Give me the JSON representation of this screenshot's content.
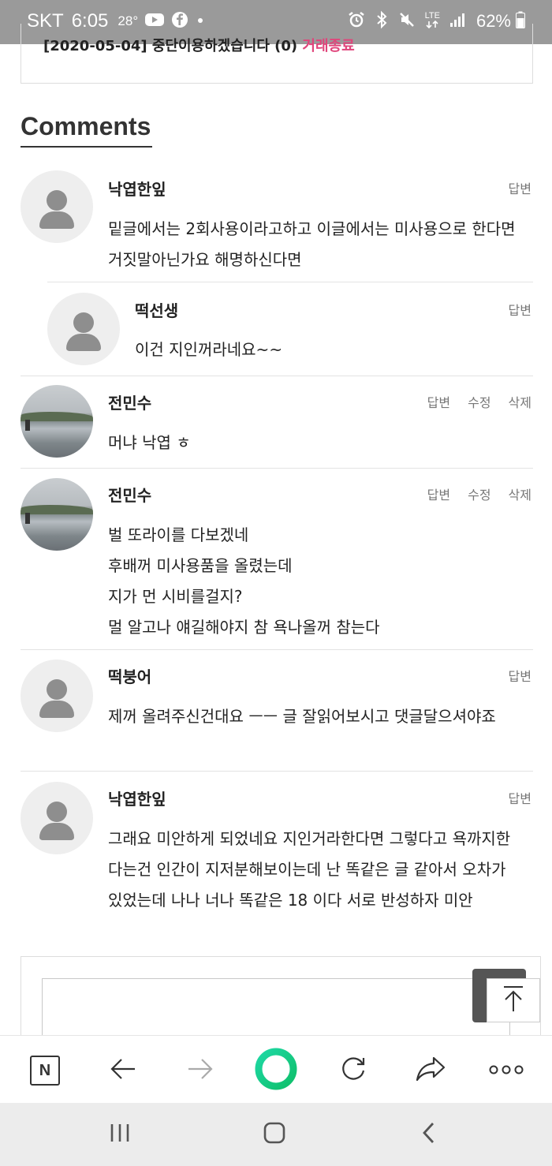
{
  "status_bar": {
    "carrier": "SKT",
    "time": "6:05",
    "temperature": "28°",
    "lte": "LTE",
    "battery": "62%"
  },
  "post": {
    "line_text": "[2020-05-04] 중단이용하겠습니다 (0)",
    "line_tag": "거래종료"
  },
  "comments_heading": "Comments",
  "comments": [
    {
      "author": "낙엽한잎",
      "avatar": "default",
      "actions": [
        "답변"
      ],
      "text": "밑글에서는 2회사용이라고하고 이글에서는 미사용으로 한다면 거짓말아닌가요 해명하신다면"
    },
    {
      "author": "떡선생",
      "avatar": "default",
      "actions": [
        "답변"
      ],
      "text": "이건 지인꺼라네요~~"
    },
    {
      "author": "전민수",
      "avatar": "photo",
      "actions": [
        "답변",
        "수정",
        "삭제"
      ],
      "text": "머냐 낙엽 ㅎ"
    },
    {
      "author": "전민수",
      "avatar": "photo",
      "actions": [
        "답변",
        "수정",
        "삭제"
      ],
      "lines": [
        "벌 또라이를 다보겠네",
        "후배꺼 미사용품을 올렸는데",
        "지가 먼 시비를걸지?",
        "멀 알고나 얘길해야지 참 욕나올꺼 참는다"
      ]
    },
    {
      "author": "떡붕어",
      "avatar": "default",
      "actions": [
        "답변"
      ],
      "text": "제꺼 올려주신건대요 ㅡㅡ 글 잘읽어보시고 댓글달으셔야죠"
    },
    {
      "author": "낙엽한잎",
      "avatar": "default",
      "actions": [
        "답변"
      ],
      "text": "그래요 미안하게 되었네요 지인거라한다면 그렇다고 욕까지한다는건 인간이 지저분해보이는데  난 똑같은 글 같아서 오차가 있었는데 나나 너나 똑같은  18 이다 서로 반성하자 미안"
    }
  ],
  "toolbar": {
    "naver_label": "N",
    "icons": [
      "naver-home-icon",
      "back-arrow-icon",
      "forward-arrow-icon",
      "green-dot-icon",
      "refresh-icon",
      "share-icon",
      "more-icon"
    ]
  },
  "colors": {
    "status_bar_bg": "#9a9a9a",
    "accent_pink": "#e0457b",
    "green_button": "#1ed8a4"
  }
}
